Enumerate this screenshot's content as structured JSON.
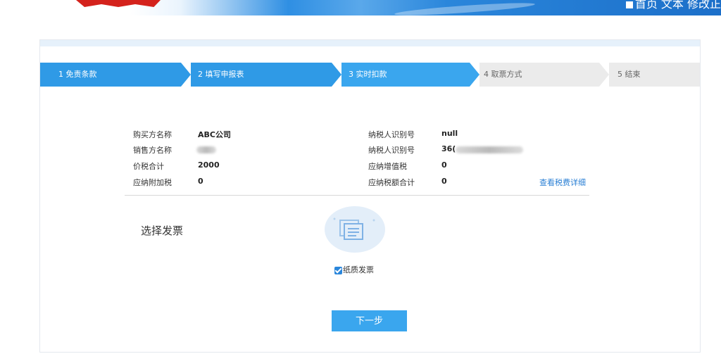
{
  "header": {
    "links_text": "首页 文本 修改正"
  },
  "steps": [
    {
      "label": "1 免责条款"
    },
    {
      "label": "2 填写申报表"
    },
    {
      "label": "3 实时扣款"
    },
    {
      "label": "4 取票方式"
    },
    {
      "label": "5 结束"
    }
  ],
  "info": {
    "buyer_name_label": "购买方名称",
    "buyer_name_value": "ABC公司",
    "seller_name_label": "销售方名称",
    "total_label": "价税合计",
    "total_value": "2000",
    "surtax_label": "应纳附加税",
    "surtax_value": "0",
    "buyer_taxid_label": "纳税人识别号",
    "buyer_taxid_value": "null",
    "seller_taxid_label": "纳税人识别号",
    "seller_taxid_value": "36(",
    "vat_label": "应纳增值税",
    "vat_value": "0",
    "tax_total_label": "应纳税额合计",
    "tax_total_value": "0",
    "detail_link": "查看税费详细"
  },
  "invoice": {
    "section_title": "选择发票",
    "paper_label": "纸质发票",
    "paper_checked": true,
    "icon": "document-icon"
  },
  "actions": {
    "next_label": "下一步"
  },
  "colors": {
    "primary": "#2f9ae6",
    "active": "#3aa6ee",
    "inactive": "#ebebeb",
    "link": "#2a7fd4"
  }
}
